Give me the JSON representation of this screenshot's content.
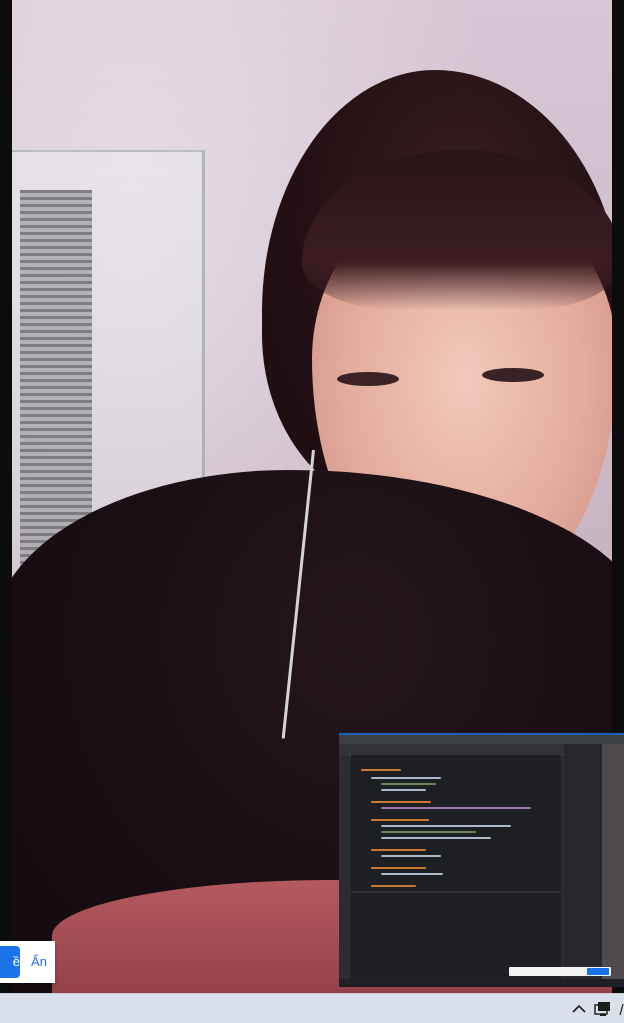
{
  "notification": {
    "primary_label": "ề",
    "secondary_label": "Ẩn"
  },
  "colors": {
    "accent": "#1a73e8",
    "taskbar": "#d9e0ec"
  },
  "icons": {
    "tray_overflow": "chevron-up-icon",
    "tray_network": "network-icon"
  }
}
